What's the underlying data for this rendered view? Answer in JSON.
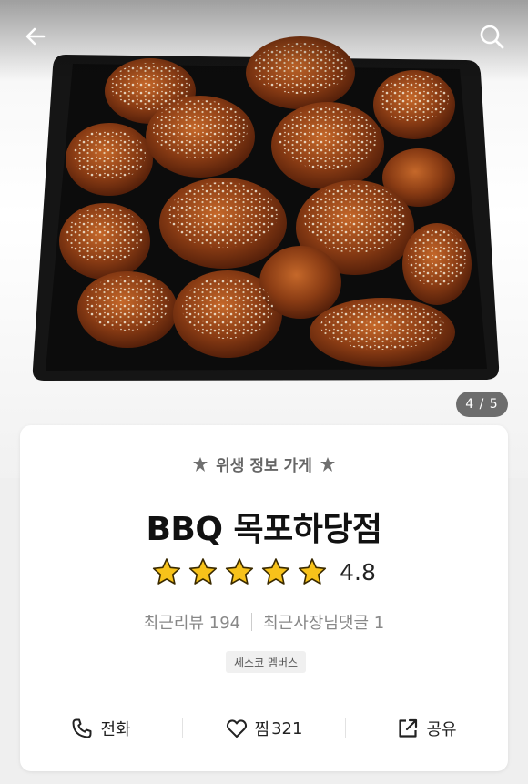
{
  "header": {
    "back_icon": "arrow-left-icon",
    "search_icon": "search-icon"
  },
  "gallery": {
    "counter": "4 / 5"
  },
  "store": {
    "badge_text": "위생 정보 가게",
    "name": "BBQ 목포하당점",
    "rating": "4.8",
    "stars": 5,
    "recent_reviews": "최근리뷰 194",
    "owner_replies": "최근사장님댓글 1",
    "tag": "세스코 멤버스"
  },
  "actions": {
    "call_label": "전화",
    "like_label": "찜",
    "like_count": "321",
    "share_label": "공유"
  },
  "colors": {
    "star": "#f7c21a",
    "plate": "#121212"
  }
}
